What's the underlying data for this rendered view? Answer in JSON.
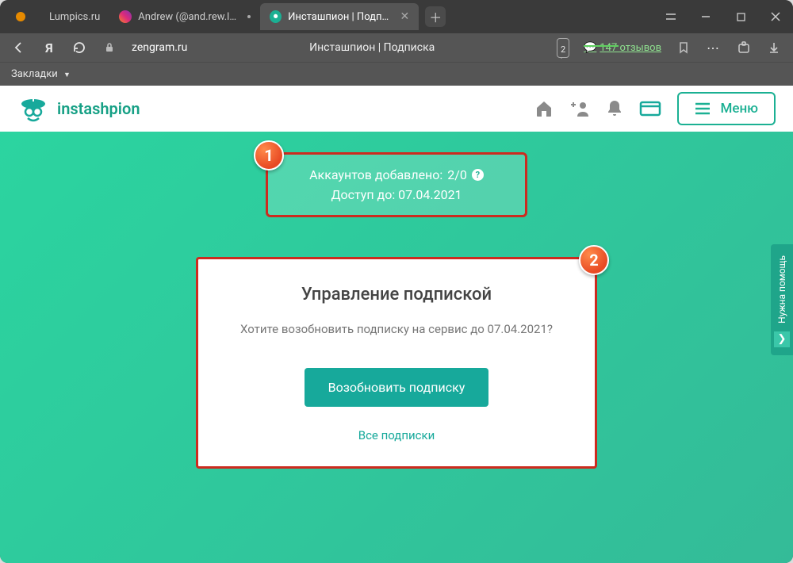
{
  "titlebar": {
    "tabs": [
      {
        "label": "Lumpics.ru"
      },
      {
        "label": "Andrew (@and.rew.lptw)"
      },
      {
        "label": "Инсташпион | Подписк"
      }
    ]
  },
  "addrbar": {
    "url_host": "zengram.ru",
    "page_title": "Инсташпион | Подписка",
    "notif_count": "2",
    "reviews": "147 отзывов"
  },
  "bookmarks": {
    "label": "Закладки"
  },
  "header": {
    "brand": "instashpion",
    "menu_label": "Меню"
  },
  "status": {
    "accounts_label": "Аккаунтов добавлено:",
    "accounts_value": "2/0",
    "access_label": "Доступ до:",
    "access_value": "07.04.2021",
    "badge": "1"
  },
  "manage": {
    "title": "Управление подпиской",
    "question": "Хотите возобновить подписку на сервис до 07.04.2021?",
    "renew_label": "Возобновить подписку",
    "all_label": "Все подписки",
    "badge": "2"
  },
  "help": {
    "label": "Нужна помощь"
  }
}
